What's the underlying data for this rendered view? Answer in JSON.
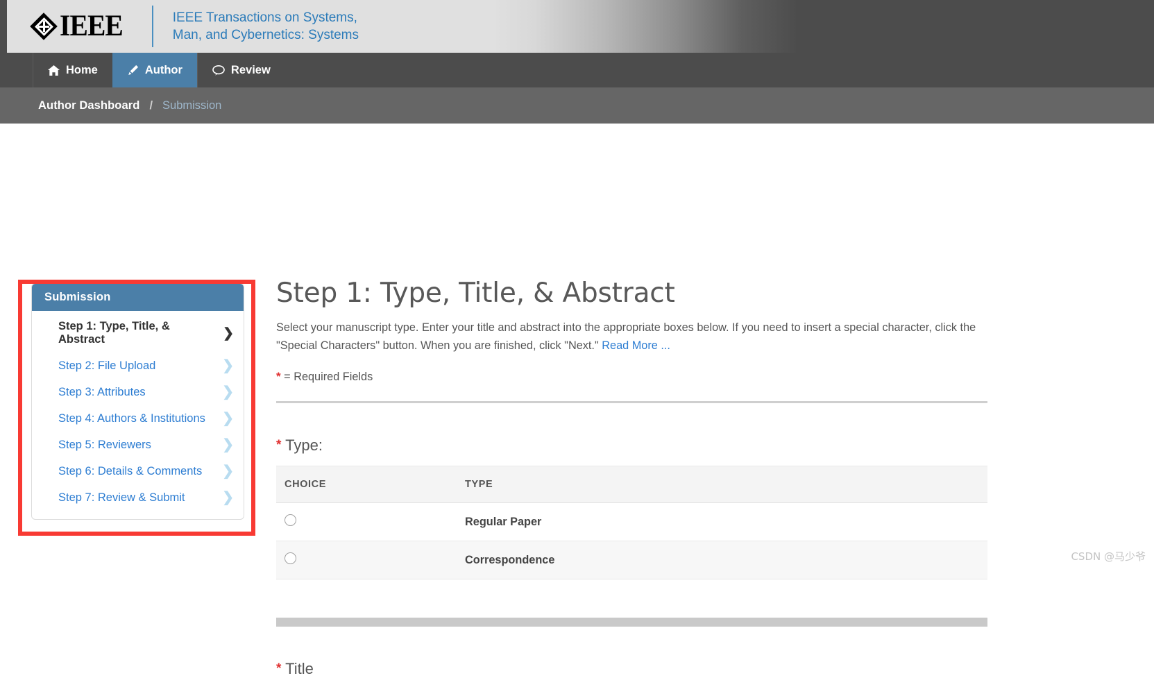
{
  "masthead": {
    "logo_text": "IEEE",
    "journal_title_line1": "IEEE Transactions on Systems,",
    "journal_title_line2": "Man, and Cybernetics: Systems",
    "accent_color": "#2b7bb9"
  },
  "nav": {
    "tabs": [
      {
        "label": "Home",
        "icon": "home-icon",
        "active": false
      },
      {
        "label": "Author",
        "icon": "pencil-icon",
        "active": true
      },
      {
        "label": "Review",
        "icon": "speech-bubble-icon",
        "active": false
      }
    ],
    "active_color": "#4b7fa8",
    "bar_color": "#4c4c4c"
  },
  "breadcrumb": {
    "current": "Author Dashboard",
    "separator": "/",
    "link": "Submission",
    "bar_color": "#666666"
  },
  "sidebar": {
    "header": "Submission",
    "header_color": "#4b7fa8",
    "highlight_color": "#f83a33",
    "items": [
      {
        "label": "Step 1: Type, Title, & Abstract",
        "current": true
      },
      {
        "label": "Step 2: File Upload",
        "current": false
      },
      {
        "label": "Step 3: Attributes",
        "current": false
      },
      {
        "label": "Step 4: Authors & Institutions",
        "current": false
      },
      {
        "label": "Step 5: Reviewers",
        "current": false
      },
      {
        "label": "Step 6: Details & Comments",
        "current": false
      },
      {
        "label": "Step 7: Review & Submit",
        "current": false
      }
    ],
    "chevron": "❯"
  },
  "main": {
    "heading": "Step 1: Type, Title, & Abstract",
    "intro_text": "Select your manuscript type. Enter your title and abstract into the appropriate boxes below. If you need to insert a special character, click the \"Special Characters\" button. When you are finished, click \"Next.\" ",
    "read_more": "Read More ...",
    "required_marker": "*",
    "required_note": "= Required Fields",
    "type_field_label": "Type:",
    "title_field_label": "Title",
    "type_table": {
      "columns": [
        "CHOICE",
        "TYPE"
      ],
      "rows": [
        {
          "choice": "radio-unselected",
          "type": "Regular Paper"
        },
        {
          "choice": "radio-unselected",
          "type": "Correspondence"
        }
      ]
    }
  },
  "watermark": "CSDN @马少爷"
}
